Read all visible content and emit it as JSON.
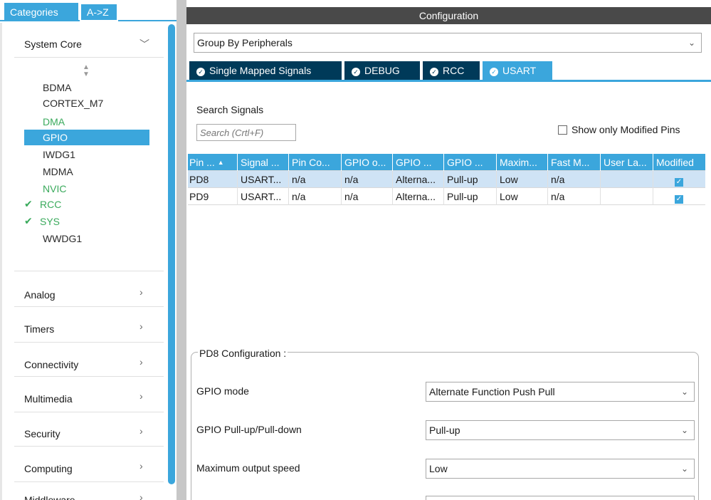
{
  "left_panel": {
    "tabs": [
      "Categories",
      "A->Z"
    ],
    "system_core": {
      "label": "System Core",
      "items": [
        {
          "label": "BDMA",
          "status": "normal"
        },
        {
          "label": "CORTEX_M7",
          "status": "normal"
        },
        {
          "label": "DMA",
          "status": "green"
        },
        {
          "label": "GPIO",
          "status": "selected"
        },
        {
          "label": "IWDG1",
          "status": "normal"
        },
        {
          "label": "MDMA",
          "status": "normal"
        },
        {
          "label": "NVIC",
          "status": "green"
        },
        {
          "label": "RCC",
          "status": "checked"
        },
        {
          "label": "SYS",
          "status": "checked"
        },
        {
          "label": "WWDG1",
          "status": "normal"
        }
      ]
    },
    "categories": [
      "Analog",
      "Timers",
      "Connectivity",
      "Multimedia",
      "Security",
      "Computing",
      "Middleware"
    ]
  },
  "right_panel": {
    "header": "Configuration",
    "group_by": "Group By Peripherals",
    "signal_tabs": [
      "Single Mapped Signals",
      "DEBUG",
      "RCC",
      "USART"
    ],
    "active_tab": "USART",
    "search_label": "Search Signals",
    "search_placeholder": "Search (Crtl+F)",
    "show_modified_label": "Show only Modified Pins",
    "table": {
      "columns": [
        "Pin ...",
        "Signal ...",
        "Pin Co...",
        "GPIO o...",
        "GPIO ...",
        "GPIO ...",
        "Maxim...",
        "Fast M...",
        "User La...",
        "Modified"
      ],
      "rows": [
        [
          "PD8",
          "USART...",
          "n/a",
          "n/a",
          "Alterna...",
          "Pull-up",
          "Low",
          "n/a",
          "",
          "checked"
        ],
        [
          "PD9",
          "USART...",
          "n/a",
          "n/a",
          "Alterna...",
          "Pull-up",
          "Low",
          "n/a",
          "",
          "checked"
        ]
      ]
    },
    "config_title": "PD8 Configuration :",
    "config_fields": [
      {
        "label": "GPIO mode",
        "value": "Alternate Function Push Pull"
      },
      {
        "label": "GPIO Pull-up/Pull-down",
        "value": "Pull-up"
      },
      {
        "label": "Maximum output speed",
        "value": "Low"
      }
    ]
  },
  "colors": {
    "accent": "#3ba6dc",
    "dark_tab": "#003a59",
    "header_bar": "#494949",
    "green": "#3aaa5c"
  }
}
